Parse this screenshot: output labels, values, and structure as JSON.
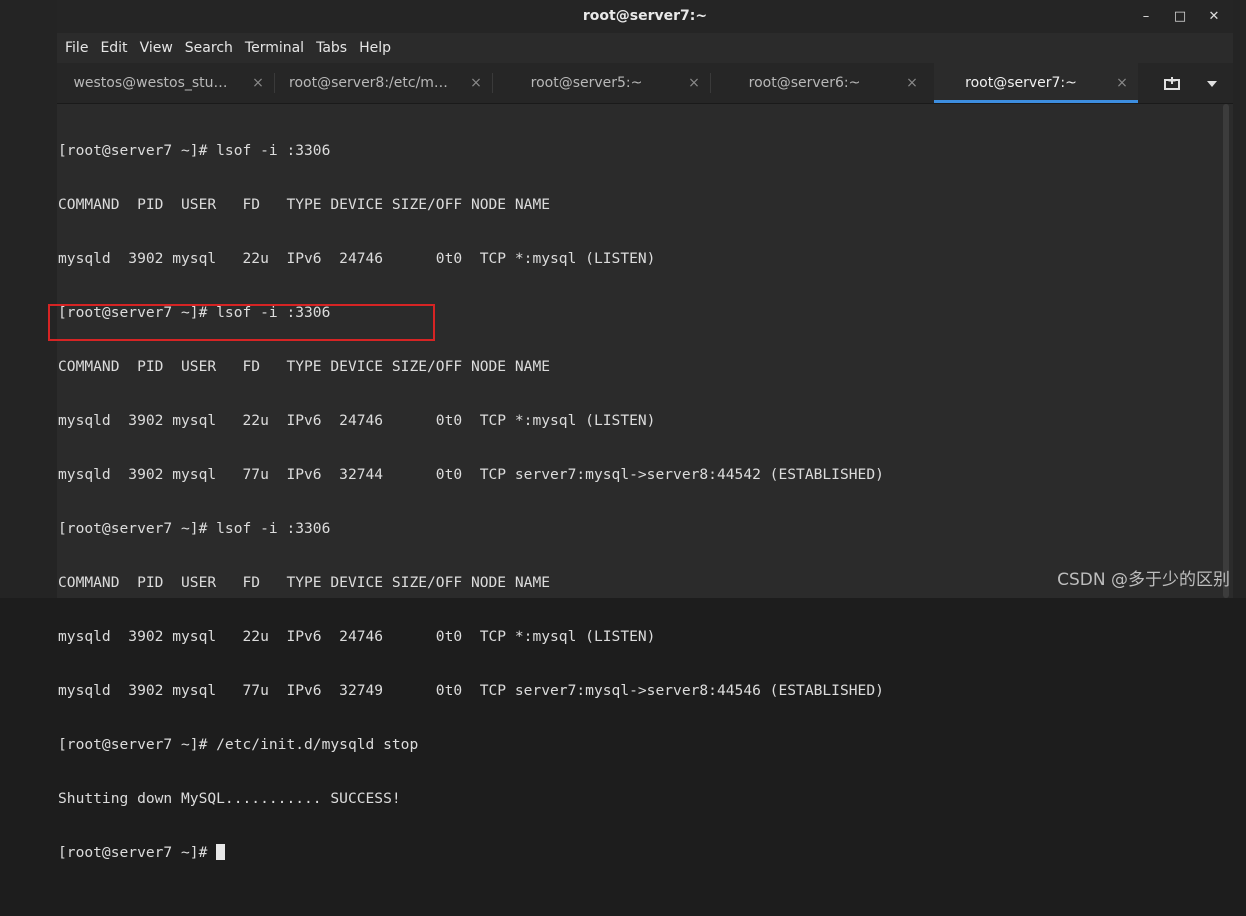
{
  "window": {
    "title": "root@server7:~"
  },
  "window_controls": {
    "minimize": "–",
    "maximize": "□",
    "close": "✕"
  },
  "menu": [
    "File",
    "Edit",
    "View",
    "Search",
    "Terminal",
    "Tabs",
    "Help"
  ],
  "tabs": [
    {
      "label": "westos@westos_stu…",
      "active": false
    },
    {
      "label": "root@server8:/etc/m…",
      "active": false
    },
    {
      "label": "root@server5:~",
      "active": false
    },
    {
      "label": "root@server6:~",
      "active": false
    },
    {
      "label": "root@server7:~",
      "active": true
    }
  ],
  "tab_close_glyph": "×",
  "terminal": {
    "lines": [
      "[root@server7 ~]# lsof -i :3306",
      "COMMAND  PID  USER   FD   TYPE DEVICE SIZE/OFF NODE NAME",
      "mysqld  3902 mysql   22u  IPv6  24746      0t0  TCP *:mysql (LISTEN)",
      "[root@server7 ~]# lsof -i :3306",
      "COMMAND  PID  USER   FD   TYPE DEVICE SIZE/OFF NODE NAME",
      "mysqld  3902 mysql   22u  IPv6  24746      0t0  TCP *:mysql (LISTEN)",
      "mysqld  3902 mysql   77u  IPv6  32744      0t0  TCP server7:mysql->server8:44542 (ESTABLISHED)",
      "[root@server7 ~]# lsof -i :3306",
      "COMMAND  PID  USER   FD   TYPE DEVICE SIZE/OFF NODE NAME",
      "mysqld  3902 mysql   22u  IPv6  24746      0t0  TCP *:mysql (LISTEN)",
      "mysqld  3902 mysql   77u  IPv6  32749      0t0  TCP server7:mysql->server8:44546 (ESTABLISHED)",
      "[root@server7 ~]# /etc/init.d/mysqld stop",
      "Shutting down MySQL........... SUCCESS!"
    ],
    "prompt": "[root@server7 ~]# "
  },
  "watermark": "CSDN @多于少的区别",
  "colors": {
    "background": "#2b2b2b",
    "text": "#dcdcdc",
    "active_tab_underline": "#3d8ee0",
    "highlight_box": "#d62424"
  }
}
